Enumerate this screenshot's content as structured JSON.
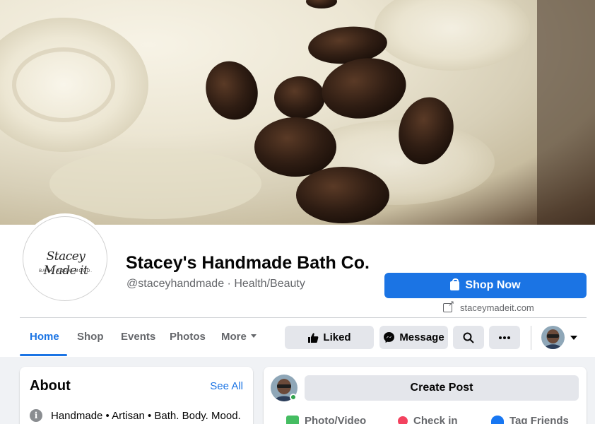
{
  "page": {
    "name": "Stacey's Handmade Bath Co.",
    "handle": "@staceyhandmade · Health/Beauty",
    "logo_text": "Stacey Made it",
    "logo_sub": "BATH. BODY. MOOD."
  },
  "cta": {
    "shop_now_label": "Shop Now",
    "website": "staceymadeit.com"
  },
  "nav": {
    "tabs": [
      {
        "label": "Home",
        "active": true
      },
      {
        "label": "Shop"
      },
      {
        "label": "Events"
      },
      {
        "label": "Photos"
      },
      {
        "label": "More"
      }
    ]
  },
  "actions": {
    "liked_label": "Liked",
    "message_label": "Message"
  },
  "about": {
    "title": "About",
    "see_all": "See All",
    "categories": "Handmade • Artisan • Bath. Body. Mood."
  },
  "composer": {
    "create_post_label": "Create Post",
    "options": [
      {
        "label": "Photo/Video",
        "icon": "photo-video-icon",
        "color": "#45bd62"
      },
      {
        "label": "Check in",
        "icon": "location-pin-icon",
        "color": "#f3425f"
      },
      {
        "label": "Tag Friends",
        "icon": "tag-friends-icon",
        "color": "#1877f2"
      }
    ]
  },
  "colors": {
    "accent": "#1b74e4",
    "online": "#31a24c"
  }
}
